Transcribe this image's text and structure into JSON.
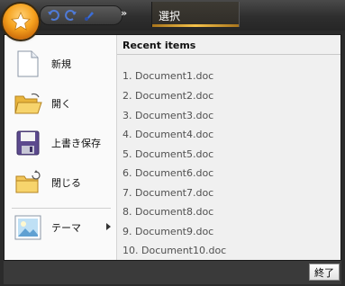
{
  "titlebar": {
    "more_label": "»",
    "tab_label": "選択"
  },
  "menu": {
    "items": [
      {
        "label": "新規",
        "icon": "new-document-icon"
      },
      {
        "label": "開く",
        "icon": "open-folder-icon"
      },
      {
        "label": "上書き保存",
        "icon": "save-disk-icon"
      },
      {
        "label": "閉じる",
        "icon": "close-folder-icon"
      },
      {
        "label": "テーマ",
        "icon": "theme-picture-icon"
      }
    ],
    "recent_header": "Recent items",
    "recent": [
      "1. Document1.doc",
      "2. Document2.doc",
      "3. Document3.doc",
      "4. Document4.doc",
      "5. Document5.doc",
      "6. Document6.doc",
      "7. Document7.doc",
      "8. Document8.doc",
      "9. Document9.doc",
      "10. Document10.doc"
    ],
    "exit_label": "終了"
  },
  "colors": {
    "accent_orange": "#f6a21e",
    "titlebar_dark": "#2e2e2e",
    "menu_bg": "#f0f0f0"
  }
}
